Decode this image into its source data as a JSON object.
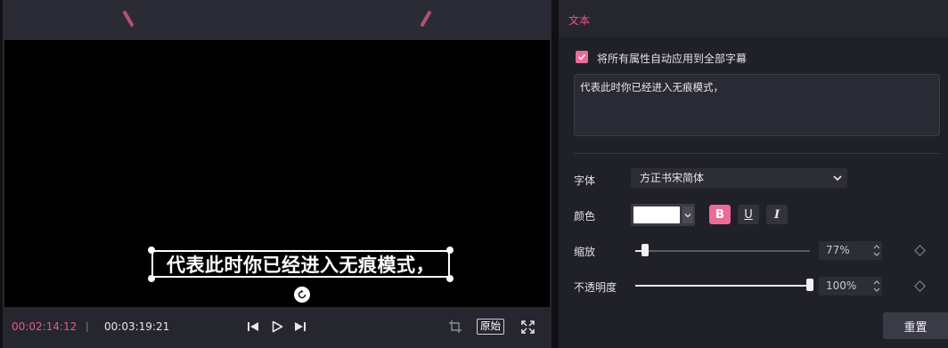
{
  "player": {
    "subtitle_text": "代表此时你已经进入无痕模式，",
    "current_time": "00:02:14:12",
    "separator": "|",
    "total_time": "00:03:19:21",
    "original_label": "原始"
  },
  "panel": {
    "title": "文本",
    "apply_all_label": "将所有属性自动应用到全部字幕",
    "apply_all_checked": true,
    "text_value": "代表此时你已经进入无痕模式，",
    "font_label": "字体",
    "font_value": "方正书宋简体",
    "color_label": "颜色",
    "color_value": "#ffffff",
    "bold_label": "B",
    "underline_label": "U",
    "italic_label": "I",
    "scale_label": "缩放",
    "scale_value": "77%",
    "scale_fraction": 0.77,
    "opacity_label": "不透明度",
    "opacity_value": "100%",
    "opacity_fraction": 1.0,
    "reset_label": "重置"
  },
  "colors": {
    "accent": "#ec6b96",
    "time_accent": "#e35a8c"
  },
  "icons": [
    "skip-back-icon",
    "play-icon",
    "skip-forward-icon",
    "crop-icon",
    "fullscreen-icon",
    "rotate-icon",
    "keyframe-icon",
    "check-icon",
    "chevron-down-icon"
  ]
}
